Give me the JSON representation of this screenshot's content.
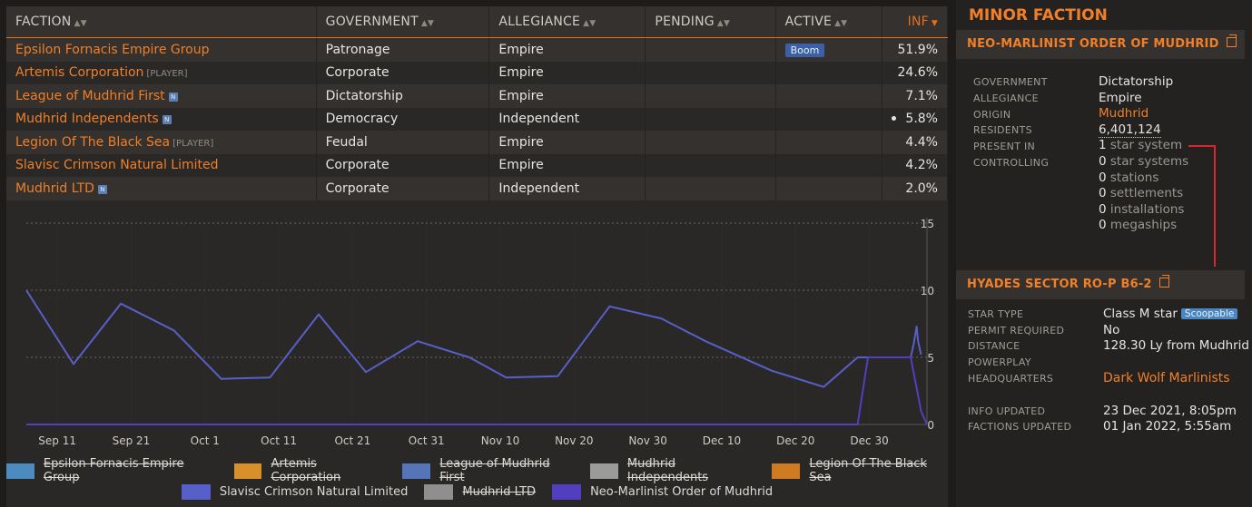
{
  "table": {
    "columns": [
      "FACTION",
      "GOVERNMENT",
      "ALLEGIANCE",
      "PENDING",
      "ACTIVE",
      "INF"
    ],
    "rows": [
      {
        "name": "Epsilon Fornacis Empire Group",
        "tag": "",
        "n": false,
        "government": "Patronage",
        "allegiance": "Empire",
        "pending": "",
        "active": "Boom",
        "dot": false,
        "inf": "51.9%"
      },
      {
        "name": "Artemis Corporation",
        "tag": "[PLAYER]",
        "n": false,
        "government": "Corporate",
        "allegiance": "Empire",
        "pending": "",
        "active": "",
        "dot": false,
        "inf": "24.6%"
      },
      {
        "name": "League of Mudhrid First",
        "tag": "",
        "n": true,
        "government": "Dictatorship",
        "allegiance": "Empire",
        "pending": "",
        "active": "",
        "dot": false,
        "inf": "7.1%"
      },
      {
        "name": "Mudhrid Independents",
        "tag": "",
        "n": true,
        "government": "Democracy",
        "allegiance": "Independent",
        "pending": "",
        "active": "",
        "dot": true,
        "inf": "5.8%"
      },
      {
        "name": "Legion Of The Black Sea",
        "tag": "[PLAYER]",
        "n": false,
        "government": "Feudal",
        "allegiance": "Empire",
        "pending": "",
        "active": "",
        "dot": false,
        "inf": "4.4%"
      },
      {
        "name": "Slavisc Crimson Natural Limited",
        "tag": "",
        "n": false,
        "government": "Corporate",
        "allegiance": "Empire",
        "pending": "",
        "active": "",
        "dot": false,
        "inf": "4.2%"
      },
      {
        "name": "Mudhrid LTD",
        "tag": "",
        "n": true,
        "government": "Corporate",
        "allegiance": "Independent",
        "pending": "",
        "active": "",
        "dot": false,
        "inf": "2.0%"
      }
    ],
    "n_badge": "N"
  },
  "chart_data": {
    "type": "line",
    "x_ticks": [
      "Sep 11",
      "Sep 21",
      "Oct 1",
      "Oct 11",
      "Oct 21",
      "Oct 31",
      "Nov 10",
      "Nov 20",
      "Nov 30",
      "Dec 10",
      "Dec 20",
      "Dec 30"
    ],
    "y_ticks": [
      0,
      5,
      10,
      15
    ],
    "ylim": [
      0,
      15
    ],
    "grid": true,
    "series": [
      {
        "name": "Slavisc Crimson Natural Limited",
        "color": "#5760c8",
        "x": [
          0,
          3.2,
          6.4,
          10,
          13.2,
          16.5,
          19.8,
          23,
          26.5,
          30,
          32.5,
          36,
          39.5,
          43,
          46,
          50.5,
          54,
          56.3,
          56.6,
          56.9,
          57.6,
          59.9,
          60.1,
          60.3,
          60.4,
          60.6
        ],
        "y": [
          10,
          4.5,
          9,
          7,
          3.4,
          3.5,
          8.2,
          3.9,
          6.2,
          5,
          3.5,
          3.6,
          8.8,
          7.9,
          6.2,
          4,
          2.8,
          5,
          5,
          5,
          5,
          5,
          6,
          7.3,
          6.2,
          5.2
        ]
      },
      {
        "name": "Neo-Marlinist Order of Mudhrid",
        "color": "#5040c0",
        "x": [
          0,
          56.3,
          57,
          59.9,
          60.6,
          61
        ],
        "y": [
          0,
          0,
          5,
          5,
          1,
          0
        ]
      }
    ],
    "legend": [
      [
        {
          "label": "Epsilon Fornacis Empire Group",
          "color": "#4c8bc0",
          "off": true
        },
        {
          "label": "Artemis Corporation",
          "color": "#d98f2a",
          "off": true
        },
        {
          "label": "League of Mudhrid First",
          "color": "#5575b8",
          "off": true
        },
        {
          "label": "Mudhrid Independents",
          "color": "#9b9b9b",
          "off": true
        },
        {
          "label": "Legion Of The Black Sea",
          "color": "#d07a22",
          "off": true
        }
      ],
      [
        {
          "label": "Slavisc Crimson Natural Limited",
          "color": "#5760c8",
          "off": false
        },
        {
          "label": "Mudhrid LTD",
          "color": "#8f8f8f",
          "off": true
        },
        {
          "label": "Neo-Marlinist Order of Mudhrid",
          "color": "#5040c0",
          "off": false
        }
      ]
    ]
  },
  "panel": {
    "title": "MINOR FACTION",
    "faction_name": "NEO-MARLINIST ORDER OF MUDHRID",
    "government_label": "GOVERNMENT",
    "government": "Dictatorship",
    "allegiance_label": "ALLEGIANCE",
    "allegiance": "Empire",
    "origin_label": "ORIGIN",
    "origin": "Mudhrid",
    "residents_label": "RESIDENTS",
    "residents": "6,401,124",
    "present_label": "PRESENT IN",
    "present_num": "1",
    "present_text": " star system",
    "controlling_label": "CONTROLLING",
    "controlling": [
      {
        "num": "0",
        "text": " star systems"
      },
      {
        "num": "0",
        "text": " stations"
      },
      {
        "num": "0",
        "text": " settlements"
      },
      {
        "num": "0",
        "text": " installations"
      },
      {
        "num": "0",
        "text": " megaships"
      }
    ],
    "system_name": "HYADES SECTOR RO-P B6-2",
    "star_type_label": "STAR TYPE",
    "star_type": "Class M star",
    "scoopable": "Scoopable",
    "permit_label": "PERMIT REQUIRED",
    "permit": "No",
    "distance_label": "DISTANCE",
    "distance": "128.30 Ly from Mudhrid",
    "powerplay_label": "POWERPLAY",
    "powerplay": "",
    "hq_label": "HEADQUARTERS",
    "hq": "Dark Wolf Marlinists",
    "info_label": "INFO UPDATED",
    "info": "23 Dec 2021, 8:05pm",
    "factions_label": "FACTIONS UPDATED",
    "factions": "01 Jan 2022, 5:55am"
  }
}
